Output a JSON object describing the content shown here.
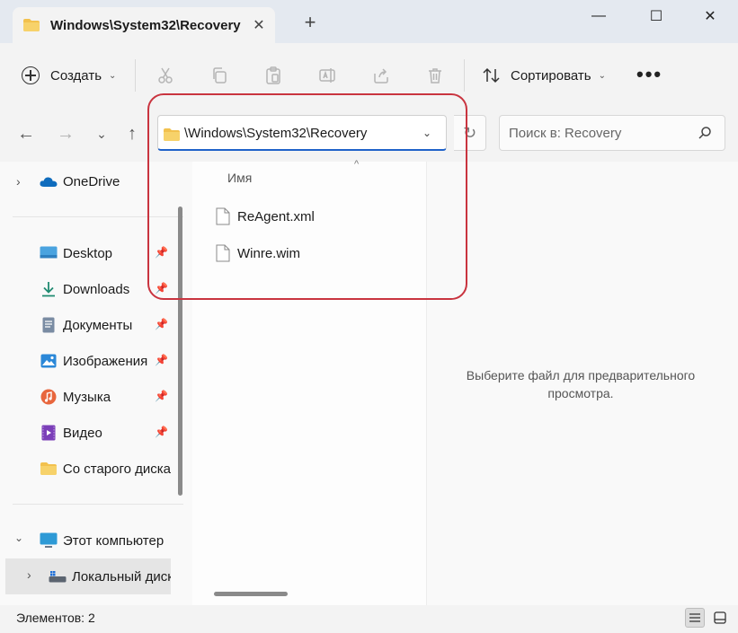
{
  "window": {
    "tab_title": "Windows\\System32\\Recovery",
    "tab_close": "✕",
    "new_tab": "+",
    "minimize": "—",
    "maximize": "☐",
    "close": "✕"
  },
  "toolbar": {
    "create_label": "Создать",
    "sort_label": "Сортировать",
    "more": "•••",
    "icons": [
      "cut-icon",
      "copy-icon",
      "paste-icon",
      "rename-icon",
      "share-icon",
      "delete-icon"
    ]
  },
  "address": {
    "path": "\\Windows\\System32\\Recovery",
    "search_placeholder": "Поиск в: Recovery"
  },
  "nav": {
    "onedrive": "OneDrive",
    "pinned": [
      {
        "label": "Desktop",
        "icon": "desktop-icon"
      },
      {
        "label": "Downloads",
        "icon": "downloads-icon"
      },
      {
        "label": "Документы",
        "icon": "documents-icon"
      },
      {
        "label": "Изображения",
        "icon": "pictures-icon"
      },
      {
        "label": "Музыка",
        "icon": "music-icon"
      },
      {
        "label": "Видео",
        "icon": "video-icon"
      },
      {
        "label": "Со старого диска",
        "icon": "folder-icon"
      }
    ],
    "this_pc": "Этот компьютер",
    "local_disk": "Локальный диск"
  },
  "content": {
    "column_name": "Имя",
    "files": [
      "ReAgent.xml",
      "Winre.wim"
    ],
    "preview_text_1": "Выберите файл для предварительного",
    "preview_text_2": "просмотра."
  },
  "status": {
    "items_count": "Элементов: 2"
  },
  "colors": {
    "accent": "#1f62c9",
    "highlight": "#c9343f",
    "folder": "#f2c14e"
  }
}
